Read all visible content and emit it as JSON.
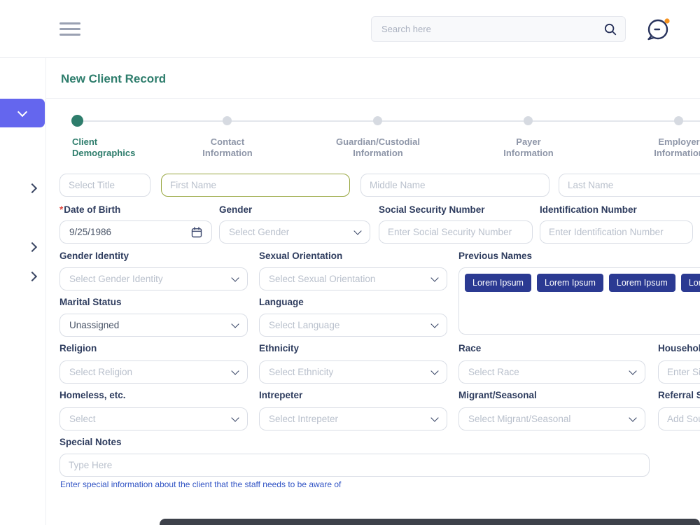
{
  "header": {
    "search_placeholder": "Search here",
    "icons": [
      "hamburger-menu-icon",
      "search-icon",
      "chat-bubble-icon"
    ]
  },
  "sidebar": {
    "active_item_icon": "chevron-down-icon",
    "collapsed_item_icons": [
      "chevron-right-icon",
      "chevron-right-icon",
      "chevron-right-icon"
    ]
  },
  "page": {
    "title": "New Client Record"
  },
  "stepper": {
    "steps": [
      {
        "line1": "Client",
        "line2": "Demographics",
        "active": true
      },
      {
        "line1": "Contact",
        "line2": "Information",
        "active": false
      },
      {
        "line1": "Guardian/Custodial",
        "line2": "Information",
        "active": false
      },
      {
        "line1": "Payer",
        "line2": "Information",
        "active": false
      },
      {
        "line1": "Employer",
        "line2": "Information",
        "active": false
      }
    ]
  },
  "form": {
    "row1": {
      "title_ph": "Select Title",
      "first_name_ph": "First Name",
      "middle_name_ph": "Middle Name",
      "last_name_ph": "Last Name"
    },
    "dob": {
      "required_mark": "*",
      "label": "Date of Birth",
      "value": "9/25/1986"
    },
    "gender": {
      "label": "Gender",
      "ph": "Select Gender"
    },
    "ssn": {
      "label": "Social Security Number",
      "ph": "Enter Social Security Number"
    },
    "idnum": {
      "label": "Identification Number",
      "ph": "Enter Identification Number"
    },
    "gender_identity": {
      "label": "Gender Identity",
      "ph": "Select Gender Identity"
    },
    "sexual_orientation": {
      "label": "Sexual Orientation",
      "ph": "Select Sexual Orientation"
    },
    "previous_names": {
      "label": "Previous Names",
      "chips": [
        "Lorem Ipsum",
        "Lorem Ipsum",
        "Lorem Ipsum",
        "Lorem Ipsum"
      ]
    },
    "marital_status": {
      "label": "Marital Status",
      "value": "Unassigned"
    },
    "language": {
      "label": "Language",
      "ph": "Select Language"
    },
    "religion": {
      "label": "Religion",
      "ph": "Select Religion"
    },
    "ethnicity": {
      "label": "Ethnicity",
      "ph": "Select Ethnicity"
    },
    "race": {
      "label": "Race",
      "ph": "Select Race"
    },
    "household": {
      "label": "Household Size",
      "ph": "Enter Size"
    },
    "homeless": {
      "label": "Homeless, etc.",
      "ph": "Select"
    },
    "interpreter": {
      "label": "Intrepeter",
      "ph": "Select Intrepeter"
    },
    "migrant": {
      "label": "Migrant/Seasonal",
      "ph": "Select Migrant/Seasonal"
    },
    "referral": {
      "label": "Referral Source",
      "ph": "Add Source"
    },
    "special_notes": {
      "label": "Special Notes",
      "ph": "Type Here",
      "helper": "Enter special information about the client that the staff needs to be aware of"
    }
  },
  "colors": {
    "accent_green": "#2e7d6c",
    "sidebar_active_purple": "#6466ee",
    "chip_navy": "#2b3a92",
    "helper_blue": "#3053c4",
    "required_red": "#e0493f",
    "notification_orange": "#f6921e"
  }
}
